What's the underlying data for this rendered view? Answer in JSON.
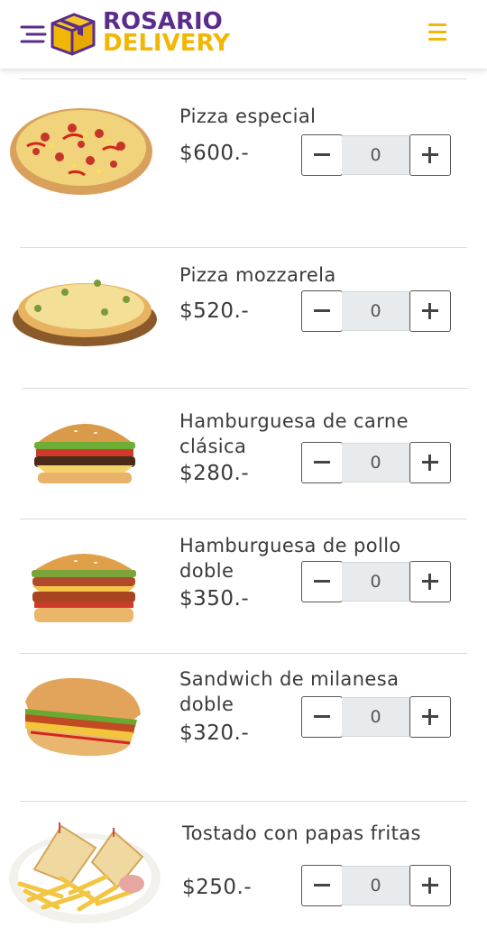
{
  "header": {
    "brand_line1": "ROSARIO",
    "brand_line2": "DELIVERY",
    "menu_icon": "hamburger-menu-icon",
    "colors": {
      "purple": "#5a2d8c",
      "yellow": "#f2b705"
    }
  },
  "items": [
    {
      "name": "Pizza especial",
      "price": "$600.-",
      "qty": "0",
      "image": "pizza-especial"
    },
    {
      "name": "Pizza mozzarela",
      "price": "$520.-",
      "qty": "0",
      "image": "pizza-mozzarela"
    },
    {
      "name": "Hamburguesa de carne clásica",
      "price": "$280.-",
      "qty": "0",
      "image": "hamburguesa-carne"
    },
    {
      "name": "Hamburguesa de pollo doble",
      "price": "$350.-",
      "qty": "0",
      "image": "hamburguesa-pollo"
    },
    {
      "name": "Sandwich de milanesa doble",
      "price": "$320.-",
      "qty": "0",
      "image": "sandwich-milanesa"
    },
    {
      "name": "Tostado con papas fritas",
      "price": "$250.-",
      "qty": "0",
      "image": "tostado-papas"
    }
  ]
}
